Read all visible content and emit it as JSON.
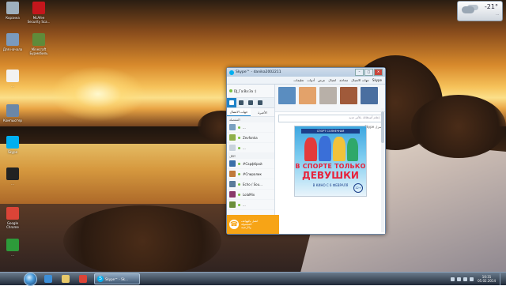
{
  "desktop": {
    "icons": [
      {
        "name": "recycle-bin-icon",
        "label": "Корзина",
        "color": "#9fb0be"
      },
      {
        "name": "mcafee-icon",
        "label": "McAfee Security Sca...",
        "color": "#c4161c"
      },
      {
        "name": "dlya-nachala-icon",
        "label": "Для начала",
        "color": "#7a9abd"
      },
      {
        "name": "minecraft-icon",
        "label": "Minecraft Бурмобиль",
        "color": "#5f8b3a"
      },
      {
        "name": "new-doc-icon",
        "label": "...",
        "color": "#f2f2f2"
      },
      {
        "name": "computer-icon",
        "label": "Компьютер",
        "color": "#6b87a7"
      },
      {
        "name": "skype-desktop-icon",
        "label": "Skype",
        "color": "#00aff0"
      },
      {
        "name": "cs-icon",
        "label": "...",
        "color": "#222222"
      },
      {
        "name": "chrome-desktop-icon",
        "label": "Google Chrome",
        "color": "#db4437"
      },
      {
        "name": "green-app-icon",
        "label": "...",
        "color": "#2d9b3a"
      }
    ]
  },
  "gadget": {
    "temp": "-21°",
    "place": "..."
  },
  "skype": {
    "title": "Skype™ - danika2002211",
    "controls": {
      "min": "–",
      "max": "□",
      "close": "✕"
    },
    "menu": [
      "Skype",
      "جهات الاتصال",
      "محادثة",
      "اتصال",
      "عرض",
      "أدوات",
      "تعليمات"
    ],
    "profile_name": "DJ_Га:Ва:За :)",
    "subtabs": {
      "contacts": "جهات الاتصال",
      "recent": "الأخيرة"
    },
    "favorites_label": "المفضلة",
    "contacts": [
      {
        "name": "...",
        "color": "#7aa0c0"
      },
      {
        "name": "Zevfonka",
        "color": "#8fb04a"
      },
      {
        "name": "...",
        "color": "#c9d3dc"
      },
      {
        "name": "#Сарфброй",
        "color": "#3a6fa8"
      },
      {
        "name": "#Спиралик",
        "color": "#c07a3a"
      },
      {
        "name": "Echo / Sou...",
        "color": "#5a7b9a"
      },
      {
        "name": "LolaMix",
        "color": "#8a3a6a"
      },
      {
        "name": "...",
        "color": "#6b8f3a"
      }
    ],
    "all_label": "الكل",
    "promo": {
      "line1": "اتصل بالهواتف",
      "line2": "المحمولة",
      "line3": "والأرضية"
    },
    "top_label": "Skype منزل",
    "avatars": [
      {
        "name": "avatar-1",
        "color": "#5a8dc0"
      },
      {
        "name": "avatar-2",
        "color": "#e3a26a"
      },
      {
        "name": "avatar-3",
        "color": "#b8b0a8"
      },
      {
        "name": "avatar-4",
        "color": "#a05a3a"
      },
      {
        "name": "avatar-5",
        "color": "#4a6fa0"
      }
    ],
    "compose_placeholder": "إعلام أصدقائك بالأمر جديد",
    "feed_left": "",
    "ad": {
      "ribbon": "СПОРТ СОЛНЕЧНАЯ",
      "line1": "В СПОРТЕ ТОЛЬКО",
      "line2": "ДЕВУШКИ",
      "line3": "В КИНО С 6 ФЕВРАЛЯ",
      "age": "12+"
    }
  },
  "taskbar": {
    "skype_label": "Skype™ - Sk...",
    "items": [
      {
        "name": "ie-icon",
        "color": "#3d8fd8"
      },
      {
        "name": "explorer-icon",
        "color": "#e8c96a"
      },
      {
        "name": "chrome-icon",
        "color": "#db4437"
      },
      {
        "name": "notepad-icon",
        "color": "#dfe8f0"
      }
    ],
    "clock_time": "10:31",
    "clock_date": "05.02.2014"
  }
}
